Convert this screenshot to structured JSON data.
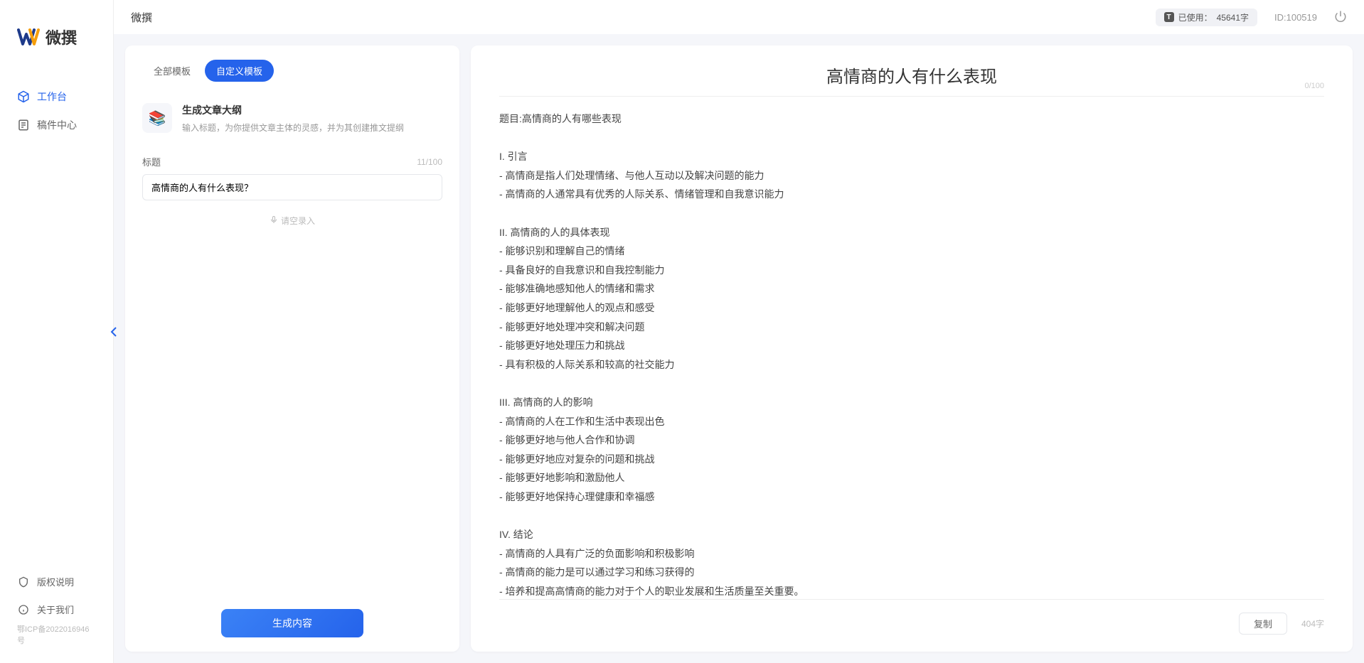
{
  "app_name": "微撰",
  "logo_text": "微撰",
  "sidebar": {
    "nav": [
      {
        "label": "工作台"
      },
      {
        "label": "稿件中心"
      }
    ],
    "bottom": [
      {
        "label": "版权说明"
      },
      {
        "label": "关于我们"
      }
    ],
    "icp": "鄂ICP备2022016946号"
  },
  "topbar": {
    "usage_label": "已使用：",
    "usage_value": "45641字",
    "user_id": "ID:100519"
  },
  "tabs": {
    "all": "全部模板",
    "custom": "自定义模板"
  },
  "template": {
    "title": "生成文章大纲",
    "desc": "输入标题，为你提供文章主体的灵感，并为其创建推文提纲"
  },
  "form": {
    "title_label": "标题",
    "title_count": "11/100",
    "title_value": "高情商的人有什么表现？",
    "voice_hint": "请空录入"
  },
  "generate_btn": "生成内容",
  "output": {
    "title": "高情商的人有什么表现",
    "top_count": "0/100",
    "body": "题目:高情商的人有哪些表现\n\nI. 引言\n- 高情商是指人们处理情绪、与他人互动以及解决问题的能力\n- 高情商的人通常具有优秀的人际关系、情绪管理和自我意识能力\n\nII. 高情商的人的具体表现\n- 能够识别和理解自己的情绪\n- 具备良好的自我意识和自我控制能力\n- 能够准确地感知他人的情绪和需求\n- 能够更好地理解他人的观点和感受\n- 能够更好地处理冲突和解决问题\n- 能够更好地处理压力和挑战\n- 具有积极的人际关系和较高的社交能力\n\nIII. 高情商的人的影响\n- 高情商的人在工作和生活中表现出色\n- 能够更好地与他人合作和协调\n- 能够更好地应对复杂的问题和挑战\n- 能够更好地影响和激励他人\n- 能够更好地保持心理健康和幸福感\n\nIV. 结论\n- 高情商的人具有广泛的负面影响和积极影响\n- 高情商的能力是可以通过学习和练习获得的\n- 培养和提高高情商的能力对于个人的职业发展和生活质量至关重要。",
    "copy_label": "复制",
    "word_count": "404字"
  }
}
